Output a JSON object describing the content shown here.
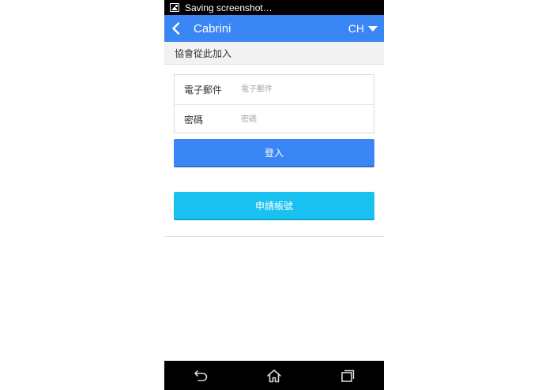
{
  "statusbar": {
    "text": "Saving screenshot…",
    "icon": "image-icon"
  },
  "appbar": {
    "title": "Cabrini",
    "language": "CH"
  },
  "section": {
    "header": "協會從此加入"
  },
  "form": {
    "email_label": "電子郵件",
    "email_placeholder": "電子郵件",
    "password_label": "密碼",
    "password_placeholder": "密碼"
  },
  "buttons": {
    "login": "登入",
    "register": "申請帳號"
  },
  "navbar": {
    "icons": [
      "back-icon",
      "home-icon",
      "recent-apps-icon"
    ]
  },
  "colors": {
    "accent": "#3b86f5",
    "register": "#19c1f0",
    "statusbar": "#000000",
    "section_bg": "#f2f2f2"
  }
}
